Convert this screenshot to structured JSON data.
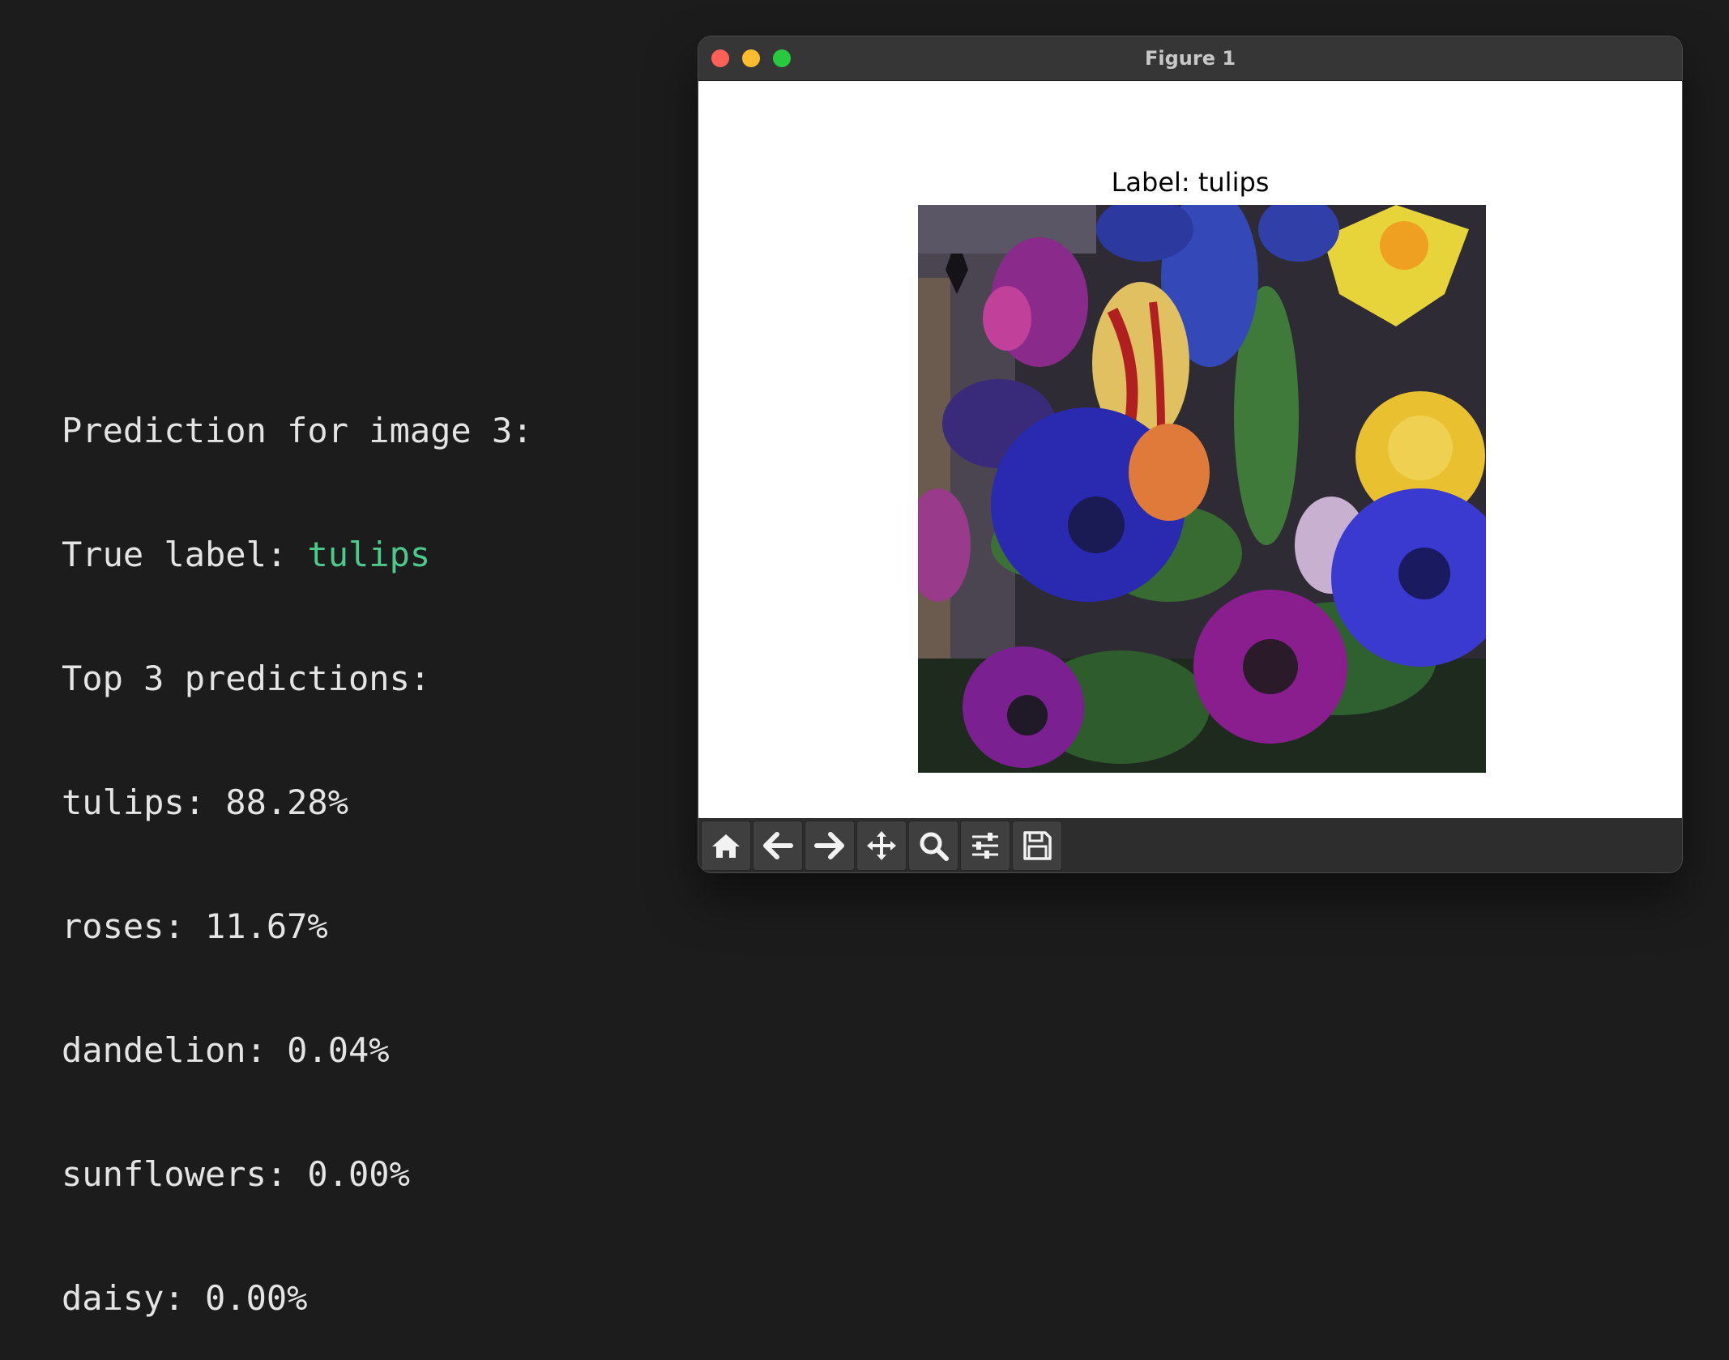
{
  "terminal": {
    "lines": [
      {
        "text": "Prediction for image 3:"
      },
      {
        "label": "True label: ",
        "value": "tulips"
      },
      {
        "text": "Top 3 predictions:"
      },
      {
        "text": "tulips: 88.28%"
      },
      {
        "text": "roses: 11.67%"
      },
      {
        "text": "dandelion: 0.04%"
      },
      {
        "text": "sunflowers: 0.00%"
      },
      {
        "text": "daisy: 0.00%"
      }
    ],
    "accent_color": "#4ec98c"
  },
  "window": {
    "title": "Figure 1",
    "axes_title": "Label: tulips",
    "image_description_icon": "flower-bouquet-image"
  },
  "toolbar": {
    "buttons": [
      {
        "icon": "home-icon"
      },
      {
        "icon": "back-arrow-icon"
      },
      {
        "icon": "forward-arrow-icon"
      },
      {
        "icon": "pan-move-icon"
      },
      {
        "icon": "zoom-magnifier-icon"
      },
      {
        "icon": "configure-subplots-icon"
      },
      {
        "icon": "save-floppy-icon"
      }
    ]
  }
}
